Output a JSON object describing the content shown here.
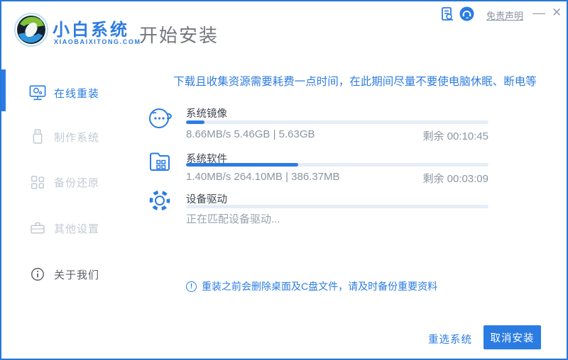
{
  "window": {
    "logo_title": "小白系统",
    "logo_subtitle": "XIAOBAIXITONG.COM",
    "page_title": "开始安装",
    "disclaimer_link": "免责声明",
    "minimize_glyph": "—",
    "close_glyph": "✕"
  },
  "sidebar": {
    "items": [
      {
        "label": "在线重装",
        "state": "active"
      },
      {
        "label": "制作系统",
        "state": "disabled"
      },
      {
        "label": "备份还原",
        "state": "disabled"
      },
      {
        "label": "其他设置",
        "state": "disabled"
      },
      {
        "label": "关于我们",
        "state": "normal"
      }
    ]
  },
  "main": {
    "warning": "下载且收集资源需要耗费一点时间，在此期间尽量不要使电脑休眠、断电等",
    "tasks": [
      {
        "name": "系统镜像",
        "progress_percent": 6,
        "stats": "8.66MB/s 5.46GB | 5.63GB",
        "remaining": "剩余 00:10:45"
      },
      {
        "name": "系统软件",
        "progress_percent": 37,
        "stats": "1.40MB/s 264.10MB | 386.37MB",
        "remaining": "剩余 00:03:09"
      },
      {
        "name": "设备驱动",
        "progress_percent": 0,
        "status": "正在匹配设备驱动..."
      }
    ],
    "notice_icon_glyph": "!",
    "notice": "重装之前会删除桌面及C盘文件，请及时备份重要资料"
  },
  "footer": {
    "reselect_label": "重选系统",
    "cancel_label": "取消安装"
  },
  "colors": {
    "accent": "#2b7ce2",
    "warning_text": "#2f7ce0",
    "progress_track": "#e6edf7",
    "inactive_gray": "#c3cad4",
    "border_blue": "#2577dd"
  }
}
